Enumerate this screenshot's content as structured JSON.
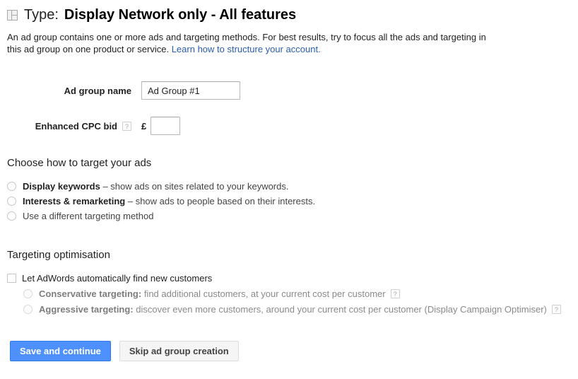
{
  "header": {
    "icon": "layout-grid-icon",
    "label": "Type:",
    "value": "Display Network only - All features"
  },
  "description": {
    "text_before_link": "An ad group contains one or more ads and targeting methods. For best results, try to focus all the ads and targeting in this ad group on one product or service. ",
    "link_text": "Learn how to structure your account."
  },
  "form": {
    "ad_group_name": {
      "label": "Ad group name",
      "value": "Ad Group #1",
      "placeholder": ""
    },
    "enhanced_cpc_bid": {
      "label": "Enhanced CPC bid",
      "help": "?",
      "currency": "£",
      "value": "",
      "placeholder": ""
    }
  },
  "targeting": {
    "title": "Choose how to target your ads",
    "options": [
      {
        "strong": "Display keywords",
        "dash": " – ",
        "rest": "show ads on sites related to your keywords.",
        "selected": false
      },
      {
        "strong": "Interests & remarketing",
        "dash": " – ",
        "rest": "show ads to people based on their interests.",
        "selected": false
      },
      {
        "strong": "",
        "dash": "",
        "rest": "Use a different targeting method",
        "selected": false
      }
    ]
  },
  "optimisation": {
    "title": "Targeting optimisation",
    "checkbox_label": "Let AdWords automatically find new customers",
    "checked": false,
    "sub_options": [
      {
        "strong": "Conservative targeting:",
        "rest": " find additional customers, at your current cost per customer",
        "help": "?",
        "disabled": true
      },
      {
        "strong": "Aggressive targeting:",
        "rest": " discover even more customers, around your current cost per customer (Display Campaign Optimiser)",
        "help": "?",
        "disabled": true
      }
    ]
  },
  "buttons": {
    "primary": "Save and continue",
    "secondary": "Skip ad group creation"
  },
  "colors": {
    "primary_button": "#4d90fe",
    "primary_button_border": "#3079ed",
    "link": "#2a5db0",
    "text": "#222222",
    "muted_text": "#8a8a8a"
  }
}
